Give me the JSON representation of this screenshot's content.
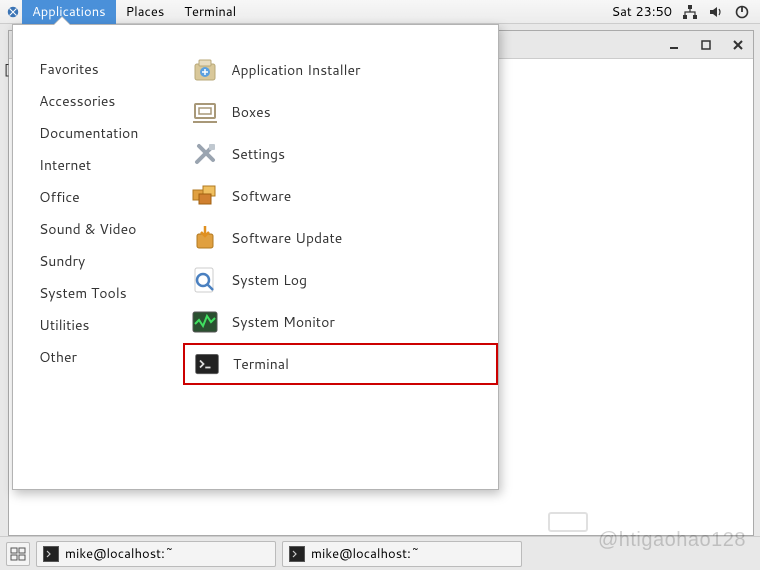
{
  "topbar": {
    "menus": [
      "Applications",
      "Places",
      "Terminal"
    ],
    "active_index": 0,
    "clock": "Sat 23:50"
  },
  "window": {
    "partial_visible_text": "["
  },
  "dropdown": {
    "categories": [
      "Favorites",
      "Accessories",
      "Documentation",
      "Internet",
      "Office",
      "Sound & Video",
      "Sundry",
      "System Tools",
      "Utilities",
      "Other"
    ],
    "apps": [
      {
        "label": "Application Installer",
        "icon": "installer"
      },
      {
        "label": "Boxes",
        "icon": "boxes"
      },
      {
        "label": "Settings",
        "icon": "settings"
      },
      {
        "label": "Software",
        "icon": "software"
      },
      {
        "label": "Software Update",
        "icon": "update"
      },
      {
        "label": "System Log",
        "icon": "log"
      },
      {
        "label": "System Monitor",
        "icon": "monitor"
      },
      {
        "label": "Terminal",
        "icon": "terminal"
      }
    ],
    "highlighted_index": 7
  },
  "taskbar": {
    "entries": [
      {
        "label": "mike@localhost:~"
      },
      {
        "label": "mike@localhost:~"
      }
    ]
  },
  "watermark": "@htigaohao128"
}
